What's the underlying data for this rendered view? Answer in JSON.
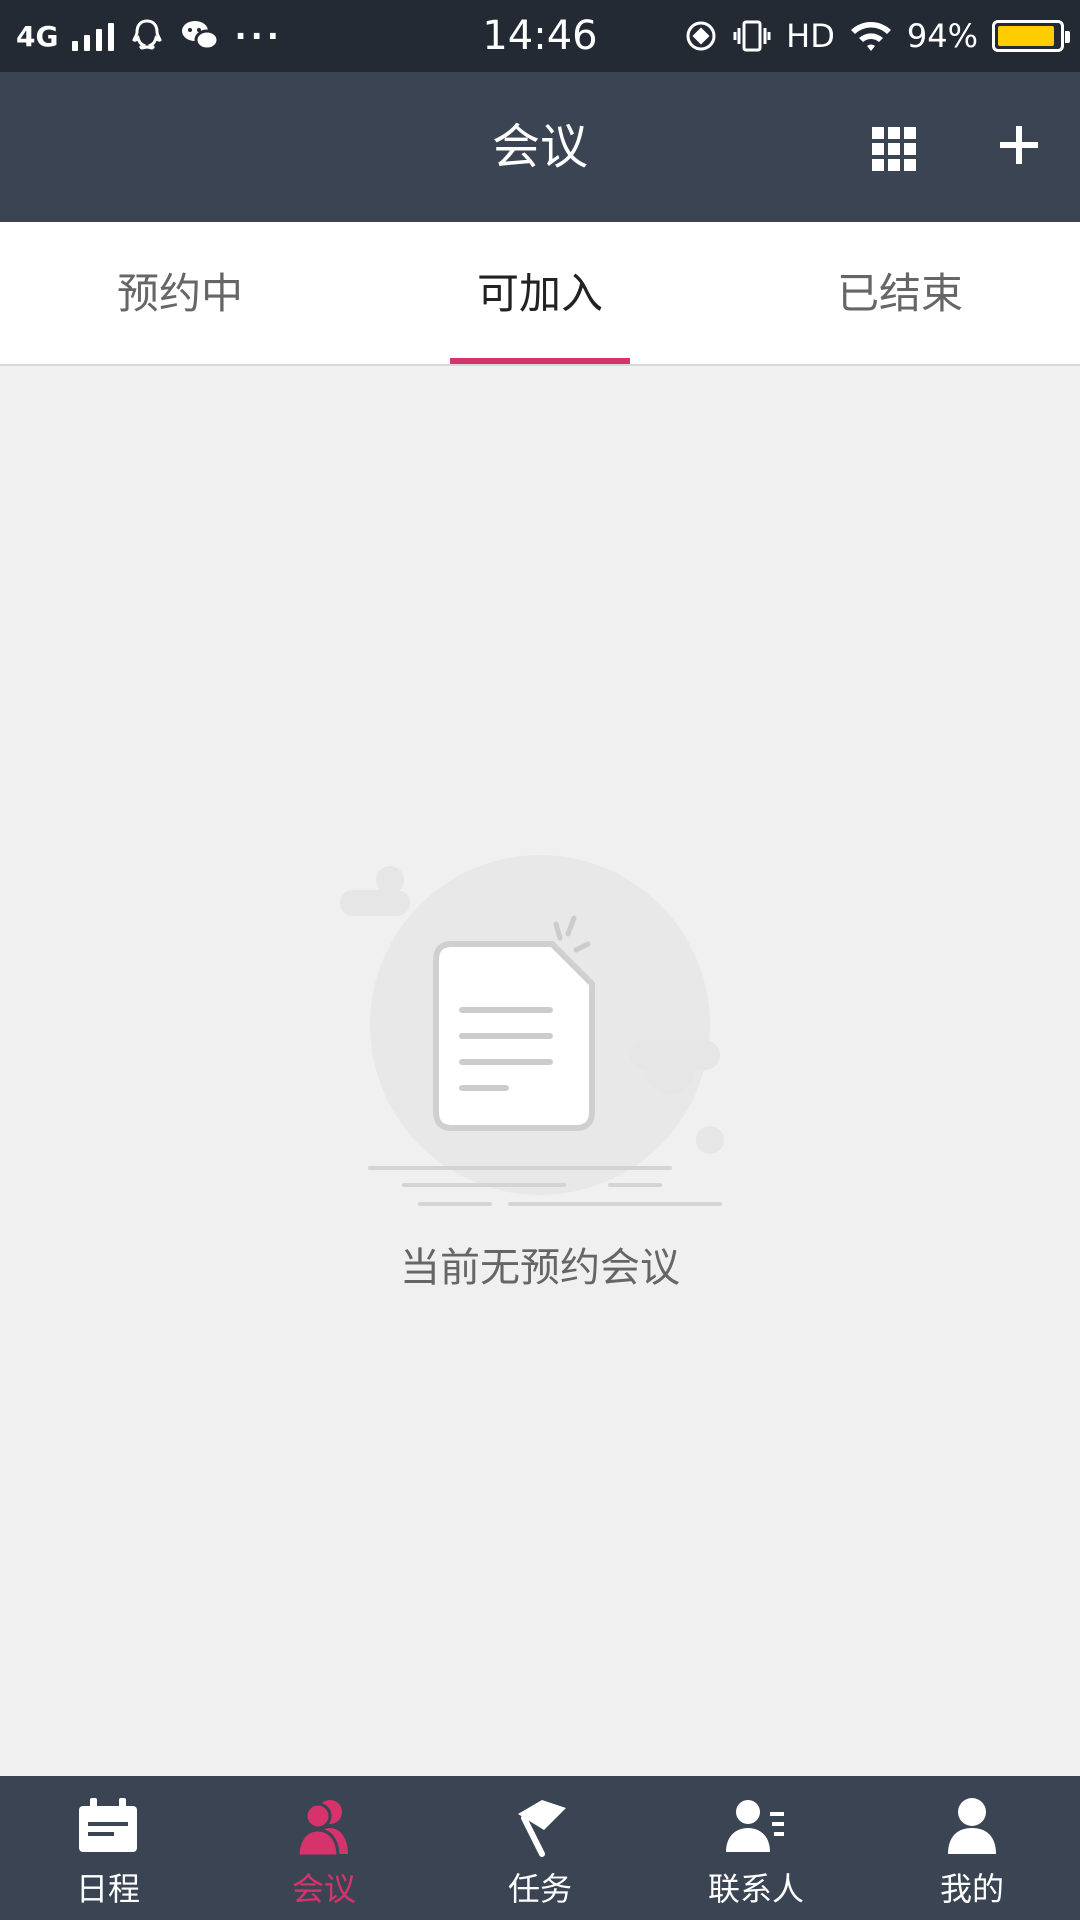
{
  "status_bar": {
    "network": "4G",
    "time": "14:46",
    "hd": "HD",
    "battery": "94%",
    "battery_level": 0.94,
    "more": "···"
  },
  "header": {
    "title": "会议",
    "grid_icon": "grid-icon",
    "add_icon": "plus-icon"
  },
  "tabs": [
    {
      "label": "预约中",
      "active": false
    },
    {
      "label": "可加入",
      "active": true
    },
    {
      "label": "已结束",
      "active": false
    }
  ],
  "empty_state": {
    "message": "当前无预约会议",
    "icon": "document-icon"
  },
  "bottom_nav": [
    {
      "label": "日程",
      "icon": "calendar-icon",
      "active": false
    },
    {
      "label": "会议",
      "icon": "meeting-people-icon",
      "active": true
    },
    {
      "label": "任务",
      "icon": "flag-icon",
      "active": false
    },
    {
      "label": "联系人",
      "icon": "contact-list-icon",
      "active": false
    },
    {
      "label": "我的",
      "icon": "user-icon",
      "active": false
    }
  ],
  "colors": {
    "header_bg": "#3a4453",
    "status_bg": "#232a34",
    "accent": "#d6336c",
    "battery": "#ffcc00"
  }
}
